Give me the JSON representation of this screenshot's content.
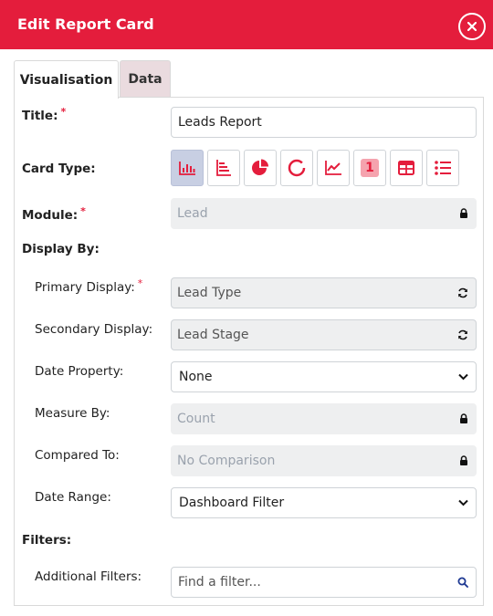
{
  "dialog": {
    "title": "Edit Report Card"
  },
  "tabs": [
    {
      "label": "Visualisation",
      "active": true
    },
    {
      "label": "Data",
      "active": false
    }
  ],
  "form": {
    "title": {
      "label": "Title:",
      "required": "*",
      "value": "Leads Report"
    },
    "card_type": {
      "label": "Card Type:",
      "options": [
        {
          "icon": "bar-chart-icon",
          "selected": true
        },
        {
          "icon": "horizontal-bar-chart-icon",
          "selected": false
        },
        {
          "icon": "pie-chart-icon",
          "selected": false
        },
        {
          "icon": "donut-chart-icon",
          "selected": false
        },
        {
          "icon": "line-chart-icon",
          "selected": false
        },
        {
          "icon": "number-card-icon",
          "text": "1",
          "selected": false
        },
        {
          "icon": "table-icon",
          "selected": false
        },
        {
          "icon": "list-icon",
          "selected": false
        }
      ]
    },
    "module": {
      "label": "Module:",
      "required": "*",
      "value": "Lead"
    },
    "display_by": {
      "label": "Display By:"
    },
    "primary_display": {
      "label": "Primary Display:",
      "required": "*",
      "value": "Lead Type"
    },
    "secondary_display": {
      "label": "Secondary Display:",
      "value": "Lead Stage"
    },
    "date_property": {
      "label": "Date Property:",
      "value": "None"
    },
    "measure_by": {
      "label": "Measure By:",
      "value": "Count"
    },
    "compared_to": {
      "label": "Compared To:",
      "value": "No Comparison"
    },
    "date_range": {
      "label": "Date Range:",
      "value": "Dashboard Filter"
    },
    "filters": {
      "label": "Filters:"
    },
    "additional_filters": {
      "label": "Additional Filters:",
      "placeholder": "Find a filter..."
    }
  },
  "colors": {
    "accent": "#e41d3c",
    "selected_card_type": "#c8cfe3",
    "locked_field": "#eeeff0"
  }
}
